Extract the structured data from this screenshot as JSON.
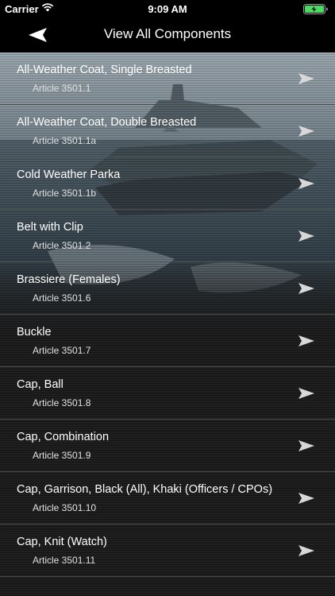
{
  "status_bar": {
    "carrier": "Carrier",
    "time": "9:09 AM"
  },
  "nav": {
    "title": "View All Components",
    "back_icon": "back-arrow-icon"
  },
  "list": {
    "items": [
      {
        "title": "All-Weather Coat, Single Breasted",
        "subtitle": "Article 3501.1"
      },
      {
        "title": "All-Weather Coat, Double Breasted",
        "subtitle": "Article 3501.1a"
      },
      {
        "title": "Cold Weather Parka",
        "subtitle": "Article 3501.1b"
      },
      {
        "title": "Belt with Clip",
        "subtitle": "Article 3501.2"
      },
      {
        "title": "Brassiere (Females)",
        "subtitle": "Article 3501.6"
      },
      {
        "title": "Buckle",
        "subtitle": "Article 3501.7"
      },
      {
        "title": "Cap, Ball",
        "subtitle": "Article 3501.8"
      },
      {
        "title": "Cap, Combination",
        "subtitle": "Article 3501.9"
      },
      {
        "title": "Cap, Garrison, Black (All), Khaki (Officers / CPOs)",
        "subtitle": "Article 3501.10"
      },
      {
        "title": "Cap, Knit (Watch)",
        "subtitle": "Article 3501.11"
      }
    ]
  },
  "colors": {
    "background": "#000000",
    "list_background": "#191919",
    "divider": "#4a4a4a",
    "battery": "#4cd964"
  }
}
